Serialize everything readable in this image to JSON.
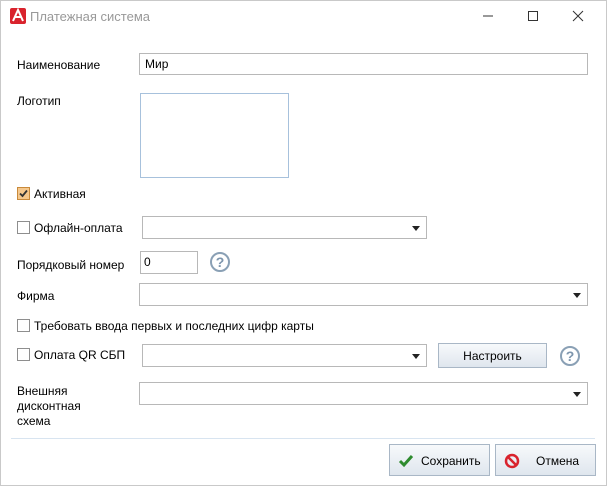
{
  "window": {
    "title": "Платежная система",
    "controls": {
      "minimize_icon": "minimize-icon",
      "maximize_icon": "maximize-icon",
      "close_icon": "close-icon"
    }
  },
  "form": {
    "name_label": "Наименование",
    "name_value": "Мир",
    "logo_label": "Логотип",
    "active_label": "Активная",
    "active_checked": true,
    "offline_label": "Офлайн-оплата",
    "offline_checked": false,
    "offline_value": "",
    "order_label": "Порядковый номер",
    "order_value": "0",
    "firm_label": "Фирма",
    "firm_value": "",
    "require_card_digits_label": "Требовать ввода первых и последних цифр карты",
    "require_card_digits_checked": false,
    "qr_label": "Оплата QR СБП",
    "qr_checked": false,
    "qr_value": "",
    "configure_label": "Настроить",
    "discount_label_line1": "Внешняя",
    "discount_label_line2": "дисконтная",
    "discount_label_line3": "схема",
    "discount_value": "",
    "help_glyph": "?"
  },
  "footer": {
    "save_label": "Сохранить",
    "cancel_label": "Отмена"
  },
  "colors": {
    "accent_check": "#f5c88d",
    "help_icon": "#7d95ad",
    "save_icon": "#2e8b2e",
    "cancel_icon": "#d9232d"
  }
}
